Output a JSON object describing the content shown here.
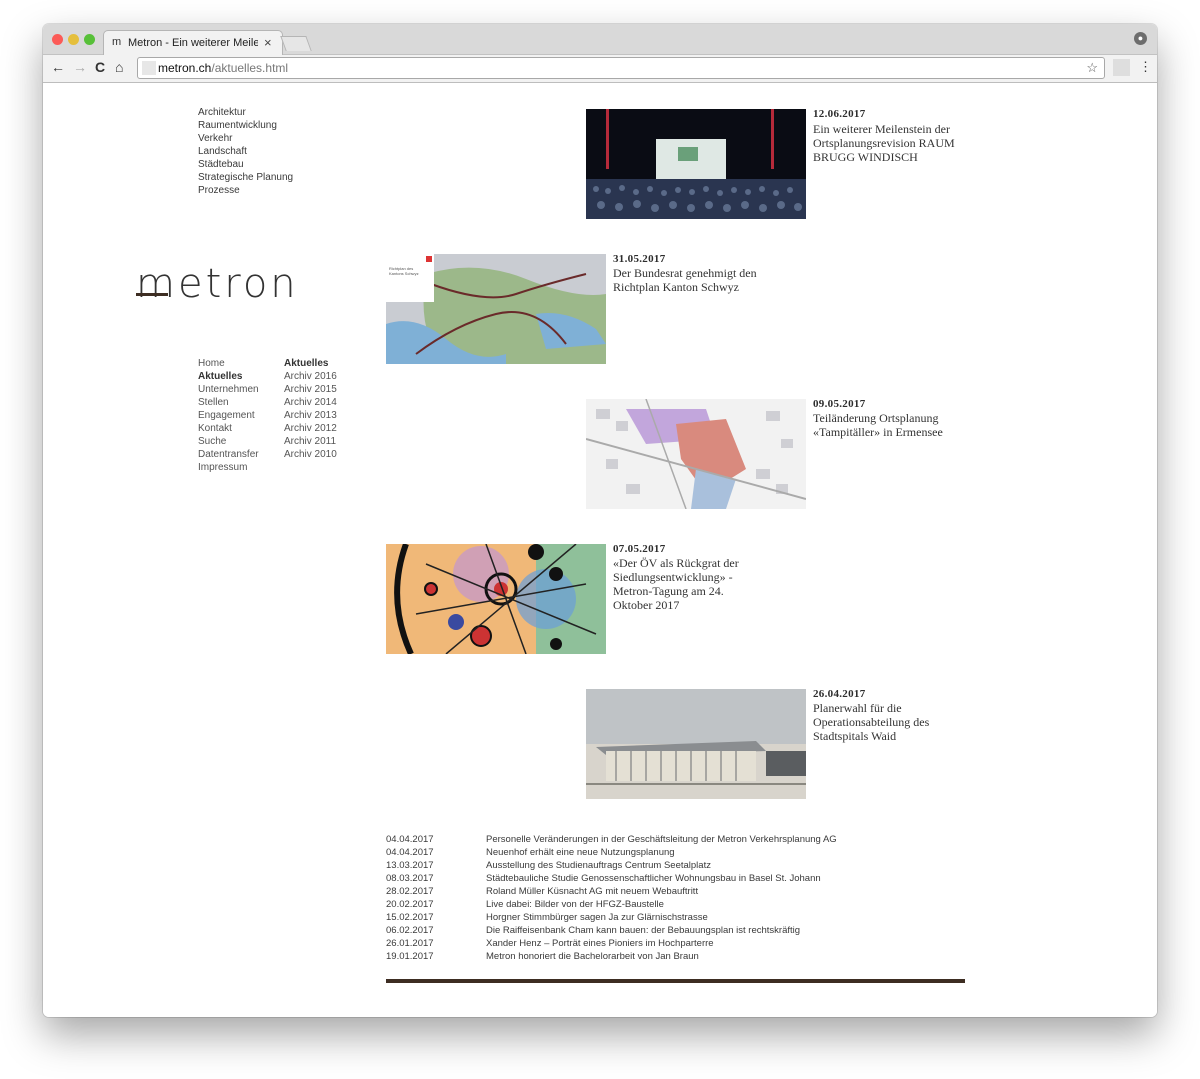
{
  "browser": {
    "tab_title": "Metron - Ein weiterer Meilenst",
    "tab_favicon": "m",
    "close_glyph": "×",
    "url_host": "metron.ch",
    "url_path": "/aktuelles.html",
    "back_glyph": "←",
    "forward_glyph": "→",
    "reload_glyph": "C",
    "home_glyph": "⌂",
    "star_glyph": "☆",
    "menu_glyph": "⋮",
    "traffic_colors": [
      "#fc5b57",
      "#e5bf3c",
      "#57c038"
    ]
  },
  "categories": [
    "Architektur",
    "Raumentwicklung",
    "Verkehr",
    "Landschaft",
    "Städtebau",
    "Strategische Planung",
    "Prozesse"
  ],
  "logo": {
    "text": "metron"
  },
  "nav": {
    "primary": [
      "Home",
      "Aktuelles",
      "Unternehmen",
      "Stellen",
      "Engagement",
      "Kontakt",
      "Suche",
      "Datentransfer",
      "Impressum"
    ],
    "primary_active": "Aktuelles",
    "archive": [
      "Aktuelles",
      "Archiv 2016",
      "Archiv 2015",
      "Archiv 2014",
      "Archiv 2013",
      "Archiv 2012",
      "Archiv 2011",
      "Archiv 2010"
    ]
  },
  "news": [
    {
      "date": "12.06.2017",
      "title": "Ein weiterer Meilenstein der Ortsplanungsrevision RAUM BRUGG WINDISCH",
      "image": "conference-hall-photo"
    },
    {
      "date": "31.05.2017",
      "title": "Der Bundesrat genehmigt den Richtplan Kanton Schwyz",
      "image": "richtplan-map",
      "image_text": "Richtplan des Kantons Schwyz"
    },
    {
      "date": "09.05.2017",
      "title": "Teiländerung Ortsplanung «Tampitäller» in Ermensee",
      "image": "zoning-plan-map"
    },
    {
      "date": "07.05.2017",
      "title": "«Der ÖV als Rückgrat der Siedlungsentwicklung» - Metron-Tagung am 24. Oktober 2017",
      "image": "abstract-circles-art"
    },
    {
      "date": "26.04.2017",
      "title": "Planerwahl für die Operationsabteilung des Stadtspitals Waid",
      "image": "hospital-building-render"
    }
  ],
  "list": [
    {
      "date": "04.04.2017",
      "title": "Personelle Veränderungen in der Geschäftsleitung der Metron Verkehrsplanung AG"
    },
    {
      "date": "04.04.2017",
      "title": "Neuenhof erhält eine neue Nutzungsplanung"
    },
    {
      "date": "13.03.2017",
      "title": "Ausstellung des Studienauftrags Centrum Seetalplatz"
    },
    {
      "date": "08.03.2017",
      "title": "Städtebauliche Studie Genossenschaftlicher Wohnungsbau in Basel St. Johann"
    },
    {
      "date": "28.02.2017",
      "title": "Roland Müller Küsnacht AG mit neuem Webauftritt"
    },
    {
      "date": "20.02.2017",
      "title": "Live dabei: Bilder von der HFGZ-Baustelle"
    },
    {
      "date": "15.02.2017",
      "title": "Horgner Stimmbürger sagen Ja zur Glärnischstrasse"
    },
    {
      "date": "06.02.2017",
      "title": "Die Raiffeisenbank Cham kann bauen: der Bebauungsplan ist rechtskräftig"
    },
    {
      "date": "26.01.2017",
      "title": "Xander Henz – Porträt eines Pioniers im Hochparterre"
    },
    {
      "date": "19.01.2017",
      "title": "Metron honoriert die Bachelorarbeit von Jan Braun"
    }
  ]
}
